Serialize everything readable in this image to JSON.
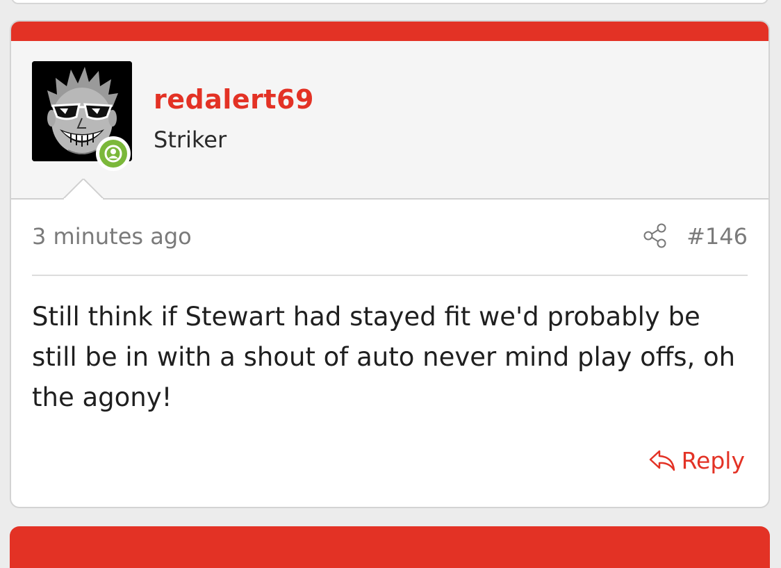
{
  "post": {
    "username": "redalert69",
    "user_title": "Striker",
    "timestamp": "3 minutes ago",
    "post_number": "#146",
    "body": "Still think if Stewart had stayed fit we'd probably be still be in with a shout of auto never mind play offs, oh the agony!",
    "reply_label": "Reply",
    "online_status": "online",
    "icons": {
      "share": "share-icon",
      "reply": "reply-icon",
      "status": "user-status-icon"
    }
  },
  "colors": {
    "accent": "#e33225",
    "online": "#7bb83a",
    "header_background": "#f5f5f5",
    "page_background": "#ececec",
    "muted_text": "#7a7a7a"
  }
}
